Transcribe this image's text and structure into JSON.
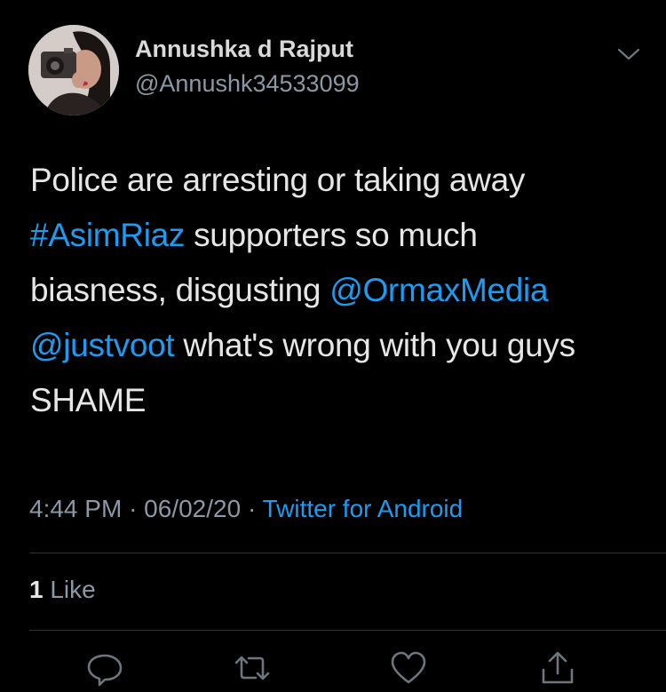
{
  "tweet": {
    "author": {
      "display_name": "Annushka d Rajput",
      "handle": "@Annushk34533099"
    },
    "text": {
      "line1": "Police are arresting or taking away",
      "hashtag": "#AsimRiaz",
      "line2_rest": " supporters so much",
      "line3_start": "biasness, disgusting ",
      "mention1": "@OrmaxMedia",
      "mention2": "@justvoot",
      "line4_rest": " what's wrong with you guys",
      "line5": "SHAME"
    },
    "time": "4:44 PM",
    "date": "06/02/20",
    "separator": "·",
    "source": "Twitter for Android",
    "likes_count": "1",
    "likes_label": "Like"
  },
  "icons": [
    "chevron-down-icon",
    "reply-icon",
    "retweet-icon",
    "like-icon",
    "share-icon"
  ],
  "colors": {
    "background": "#000000",
    "link": "#1d9bf0",
    "secondary": "#8b98a5",
    "divider": "#2f3336"
  }
}
